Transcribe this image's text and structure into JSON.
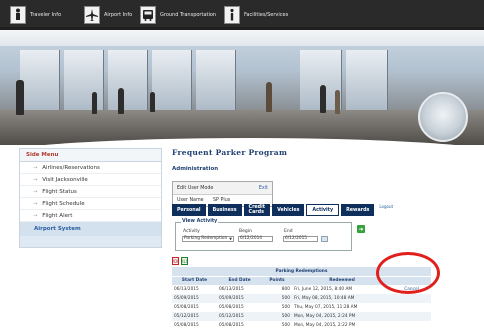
{
  "topnav": {
    "items": [
      {
        "label": "Traveler Info",
        "icon": "traveler-icon"
      },
      {
        "label": "Airport Info",
        "icon": "airplane-icon"
      },
      {
        "label": "Ground Transportation",
        "icon": "bus-icon"
      },
      {
        "label": "Facilities/Services",
        "icon": "info-icon"
      }
    ]
  },
  "sidebar": {
    "title": "Side Menu",
    "items": [
      {
        "label": "Airlines/Reservations"
      },
      {
        "label": "Visit Jacksonville"
      },
      {
        "label": "Flight Status"
      },
      {
        "label": "Flight Schedule"
      },
      {
        "label": "Flight Alert"
      }
    ],
    "section": "Airport System"
  },
  "main": {
    "title": "Frequent Parker Program",
    "admin_title": "Administration",
    "admin": {
      "mode_label": "Edit User Mode",
      "exit": "Exit",
      "user_label": "User Name",
      "user_value": "SP Plus"
    },
    "tabs": [
      {
        "label": "Personal"
      },
      {
        "label": "Business"
      },
      {
        "label": "Credit Cards"
      },
      {
        "label": "Vehicles"
      },
      {
        "label": "Activity"
      },
      {
        "label": "Rewards"
      }
    ],
    "logout": "Logout",
    "view_activity": {
      "legend": "View Activity",
      "activity_label": "Activity",
      "activity_value": "Parking Redemption",
      "begin_label": "Begin",
      "begin_value": "6/12/2014",
      "end_label": "End",
      "end_value": "6/12/2015"
    },
    "export": {
      "pdf": "PDF",
      "excel": "XLS"
    },
    "redemptions": {
      "caption": "Parking Redemptions",
      "columns": [
        "Start Date",
        "End Date",
        "Points",
        "Redeemed",
        ""
      ],
      "rows": [
        {
          "start": "06/13/2015",
          "end": "06/13/2015",
          "points": "800",
          "redeemed": "Fri, June 12, 2015, 8:40 AM",
          "action": "Cancel"
        },
        {
          "start": "05/09/2015",
          "end": "05/09/2015",
          "points": "500",
          "redeemed": "Fri, May 08, 2015, 10:48 AM",
          "action": ""
        },
        {
          "start": "05/08/2015",
          "end": "05/08/2015",
          "points": "500",
          "redeemed": "Thu, May 07, 2015, 11:28 AM",
          "action": ""
        },
        {
          "start": "05/12/2015",
          "end": "05/12/2015",
          "points": "500",
          "redeemed": "Mon, May 04, 2015, 2:24 PM",
          "action": ""
        },
        {
          "start": "05/08/2015",
          "end": "05/08/2015",
          "points": "500",
          "redeemed": "Mon, May 04, 2015, 2:22 PM",
          "action": ""
        }
      ]
    }
  },
  "colors": {
    "nav_bg": "#2a2a2a",
    "tab_bg": "#0e2e5c",
    "title": "#1f3f72",
    "side_title": "#b03a2e",
    "highlight": "#e0201c"
  }
}
